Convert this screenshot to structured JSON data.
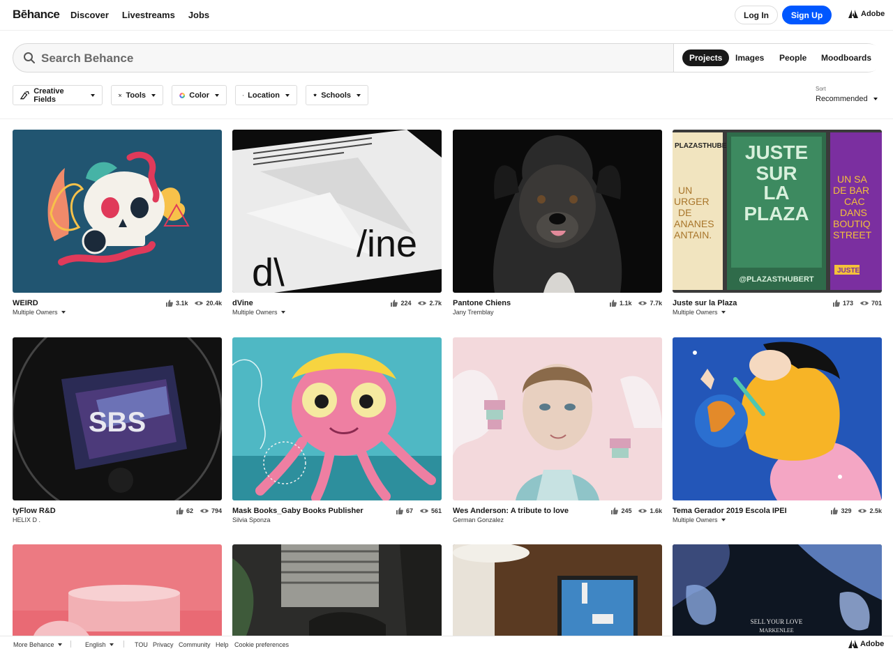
{
  "header": {
    "logo": "Bēhance",
    "nav": [
      "Discover",
      "Livestreams",
      "Jobs"
    ],
    "login_label": "Log In",
    "signup_label": "Sign Up",
    "adobe_label": "Adobe"
  },
  "search": {
    "placeholder": "Search Behance",
    "scopes": [
      "Projects",
      "Images",
      "People",
      "Moodboards"
    ],
    "active_scope": "Projects"
  },
  "filters": [
    "Creative Fields",
    "Tools",
    "Color",
    "Location",
    "Schools"
  ],
  "sort": {
    "label": "Sort",
    "value": "Recommended"
  },
  "projects": [
    {
      "title": "WEIRD",
      "owner": "Multiple Owners",
      "owner_dropdown": true,
      "likes": "3.1k",
      "views": "20.4k"
    },
    {
      "title": "dVine",
      "owner": "Multiple Owners",
      "owner_dropdown": true,
      "likes": "224",
      "views": "2.7k"
    },
    {
      "title": "Pantone Chiens",
      "owner": "Jany Tremblay",
      "owner_dropdown": false,
      "likes": "1.1k",
      "views": "7.7k"
    },
    {
      "title": "Juste sur la Plaza",
      "owner": "Multiple Owners",
      "owner_dropdown": true,
      "likes": "173",
      "views": "701"
    },
    {
      "title": "tyFlow R&D",
      "owner": "HELIX D .",
      "owner_dropdown": false,
      "likes": "62",
      "views": "794"
    },
    {
      "title": "Mask Books_Gaby Books Publisher",
      "owner": "Silvia Sponza",
      "owner_dropdown": false,
      "likes": "67",
      "views": "561"
    },
    {
      "title": "Wes Anderson: A tribute to love",
      "owner": "German Gonzalez",
      "owner_dropdown": false,
      "likes": "245",
      "views": "1.6k"
    },
    {
      "title": "Tema Gerador 2019 Escola IPEI",
      "owner": "Multiple Owners",
      "owner_dropdown": true,
      "likes": "329",
      "views": "2.5k"
    }
  ],
  "thumb_text": {
    "dvine_left": "d\\",
    "dvine_right": "/ine",
    "plaza_top": "JUSTE",
    "plaza_mid1": "SUR",
    "plaza_mid2": "LA",
    "plaza_bottom": "PLAZA",
    "plaza_handle": "@PLAZASTHUBERT",
    "plaza_left_poster": "PLAZASTHUBERT",
    "plaza_left_lines": [
      "UN",
      "URGER",
      "DE",
      "ANANES",
      "ANTAIN."
    ],
    "plaza_right_lines": [
      "UN SA",
      "DE BAR",
      "CAC",
      "DANS",
      "BOUTIQ",
      "STREET"
    ],
    "plaza_juste": "JUSTE",
    "sbs": "SBS",
    "sell_line1": "SELL YOUR LOVE",
    "sell_line2": "MARKENLEE"
  },
  "colors": {
    "signup_blue": "#0057ff",
    "weird_bg": "#215571",
    "tema_bg": "#2356b8",
    "plaza_green": "#2f6b4a",
    "plaza_purple": "#7b2fa0"
  },
  "footer": {
    "more": "More Behance",
    "language": "English",
    "links": [
      "TOU",
      "Privacy",
      "Community",
      "Help",
      "Cookie preferences"
    ],
    "adobe_label": "Adobe"
  }
}
